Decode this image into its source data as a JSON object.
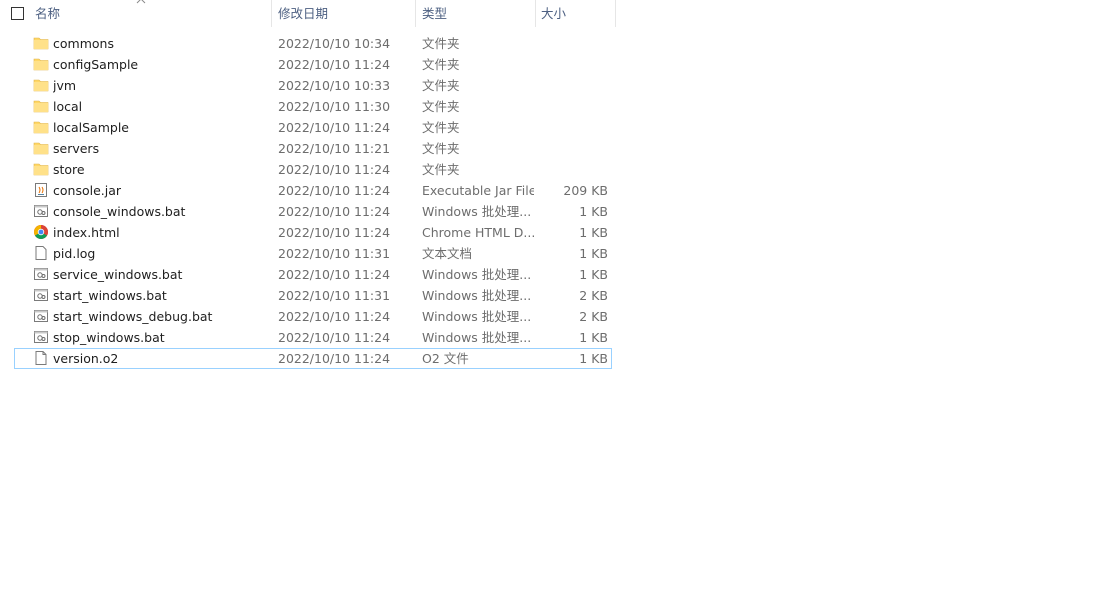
{
  "columns": {
    "name": "名称",
    "date": "修改日期",
    "type": "类型",
    "size": "大小"
  },
  "files": [
    {
      "name": "commons",
      "date": "2022/10/10 10:34",
      "type": "文件夹",
      "size": "",
      "icon": "folder-icon"
    },
    {
      "name": "configSample",
      "date": "2022/10/10 11:24",
      "type": "文件夹",
      "size": "",
      "icon": "folder-icon"
    },
    {
      "name": "jvm",
      "date": "2022/10/10 10:33",
      "type": "文件夹",
      "size": "",
      "icon": "folder-icon"
    },
    {
      "name": "local",
      "date": "2022/10/10 11:30",
      "type": "文件夹",
      "size": "",
      "icon": "folder-icon"
    },
    {
      "name": "localSample",
      "date": "2022/10/10 11:24",
      "type": "文件夹",
      "size": "",
      "icon": "folder-icon"
    },
    {
      "name": "servers",
      "date": "2022/10/10 11:21",
      "type": "文件夹",
      "size": "",
      "icon": "folder-icon"
    },
    {
      "name": "store",
      "date": "2022/10/10 11:24",
      "type": "文件夹",
      "size": "",
      "icon": "folder-icon"
    },
    {
      "name": "console.jar",
      "date": "2022/10/10 11:24",
      "type": "Executable Jar File",
      "size": "209 KB",
      "icon": "jar-icon"
    },
    {
      "name": "console_windows.bat",
      "date": "2022/10/10 11:24",
      "type": "Windows 批处理...",
      "size": "1 KB",
      "icon": "batch-file-icon"
    },
    {
      "name": "index.html",
      "date": "2022/10/10 11:24",
      "type": "Chrome HTML D...",
      "size": "1 KB",
      "icon": "chrome-icon"
    },
    {
      "name": "pid.log",
      "date": "2022/10/10 11:31",
      "type": "文本文档",
      "size": "1 KB",
      "icon": "text-file-icon"
    },
    {
      "name": "service_windows.bat",
      "date": "2022/10/10 11:24",
      "type": "Windows 批处理...",
      "size": "1 KB",
      "icon": "batch-file-icon"
    },
    {
      "name": "start_windows.bat",
      "date": "2022/10/10 11:31",
      "type": "Windows 批处理...",
      "size": "2 KB",
      "icon": "batch-file-icon"
    },
    {
      "name": "start_windows_debug.bat",
      "date": "2022/10/10 11:24",
      "type": "Windows 批处理...",
      "size": "2 KB",
      "icon": "batch-file-icon"
    },
    {
      "name": "stop_windows.bat",
      "date": "2022/10/10 11:24",
      "type": "Windows 批处理...",
      "size": "1 KB",
      "icon": "batch-file-icon"
    },
    {
      "name": "version.o2",
      "date": "2022/10/10 11:24",
      "type": "O2 文件",
      "size": "1 KB",
      "icon": "blank-file-icon",
      "focused": true
    }
  ],
  "colors": {
    "header_text": "#4d6082",
    "folder": "#ffd766",
    "focus_border": "#99d1ff"
  }
}
